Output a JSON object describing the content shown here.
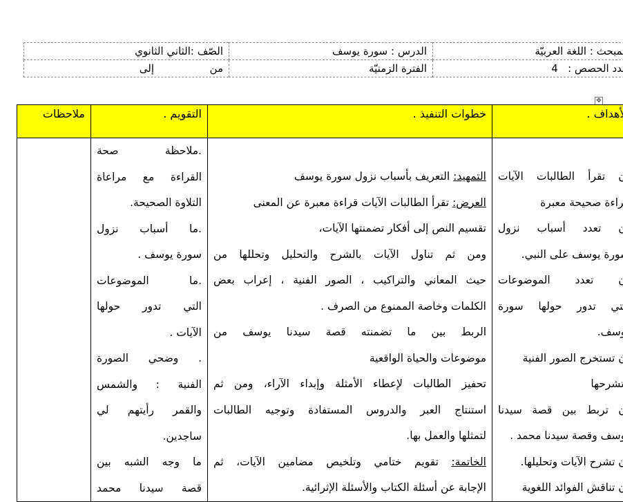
{
  "header": {
    "subject": "المبحث : اللغة العربيّة",
    "lesson": "الدرس : سورة يوسف",
    "grade": "الصّف :الثاني الثانوي",
    "periods_label": "عدد الحصص :",
    "periods_value": "4",
    "time_period": "الفترة الزمنيّة",
    "from": "من",
    "to": "إلى"
  },
  "table": {
    "headers": {
      "goals": "الأهداف .",
      "steps": "خطوات التنفيذ .",
      "evaluation": "التقويم .",
      "notes": "ملاحظات"
    },
    "goals_lines": [
      "أن تقرأ الطالبات الآيات",
      "قراءة صحيحة معبرة",
      "أن تعدد أسباب نزول",
      "سورة يوسف على النبي.",
      "أن تعدد الموضوعات",
      "التي تدور حولها سورة",
      "يوسف.",
      "أن تستخرج الصور الفنية",
      "وتشرحها",
      "أن تربط بين قصة سيدنا",
      "يوسف وقصة سيدنا محمد .",
      "أن تشرح الآيات وتحليلها.",
      "أن تناقش الفوائد اللغوية"
    ],
    "steps": {
      "intro_label": "التمهيد:",
      "intro_text": " التعريف بأسباب نزول سورة يوسف",
      "presentation_label": "العرض:",
      "presentation_text": " تقرأ الطالبات الآيات قراءة معبرة عن المعنى",
      "lines": [
        "تقسيم النص إلى أفكار تضمنتها الآيات،",
        " ومن ثم تناول الآيات بالشرح والتحليل  وتحللها من",
        "حيث المعاني والتراكيب ، الصور الفنية ، إعراب بعض",
        "الكلمات وخاصة الممنوع من الصرف .",
        "الربط بين ما تضمنته قصة سيدنا يوسف من",
        "موضوعات والحياة الواقعية",
        "تحفيز الطالبات لإعطاء الأمثلة وإبداء الآراء، ومن ثم",
        "استنتاج العبر والدروس المستفادة وتوجيه الطالبات",
        "لتمثلها والعمل بها."
      ],
      "conclusion_label": "الخاتمة:",
      "conclusion_text": " تقويم ختامي وتلخيص مضامين الآيات، ثم",
      "last_line": "الإجابة عن أسئلة الكتاب والأسئلة الإثرائية."
    },
    "evaluation_lines": [
      ".ملاحظة صحة",
      "القراءة مع مراعاة",
      "التلاوة الصحيحة.",
      ".ما أسباب نزول",
      "سورة يوسف .",
      ".ما الموضوعات",
      "التي تدور حولها",
      "الآيات .",
      ". وضحي الصورة",
      "الفنية : والشمس",
      "والقمر رأيتهم لي",
      "ساجدين.",
      " ما وجه الشبه بين",
      "قصة سيدنا محمد"
    ],
    "notes": ""
  },
  "colors": {
    "header_fill": "#ffff00",
    "border": "#000000",
    "dashed_border": "#8a8a8a"
  }
}
